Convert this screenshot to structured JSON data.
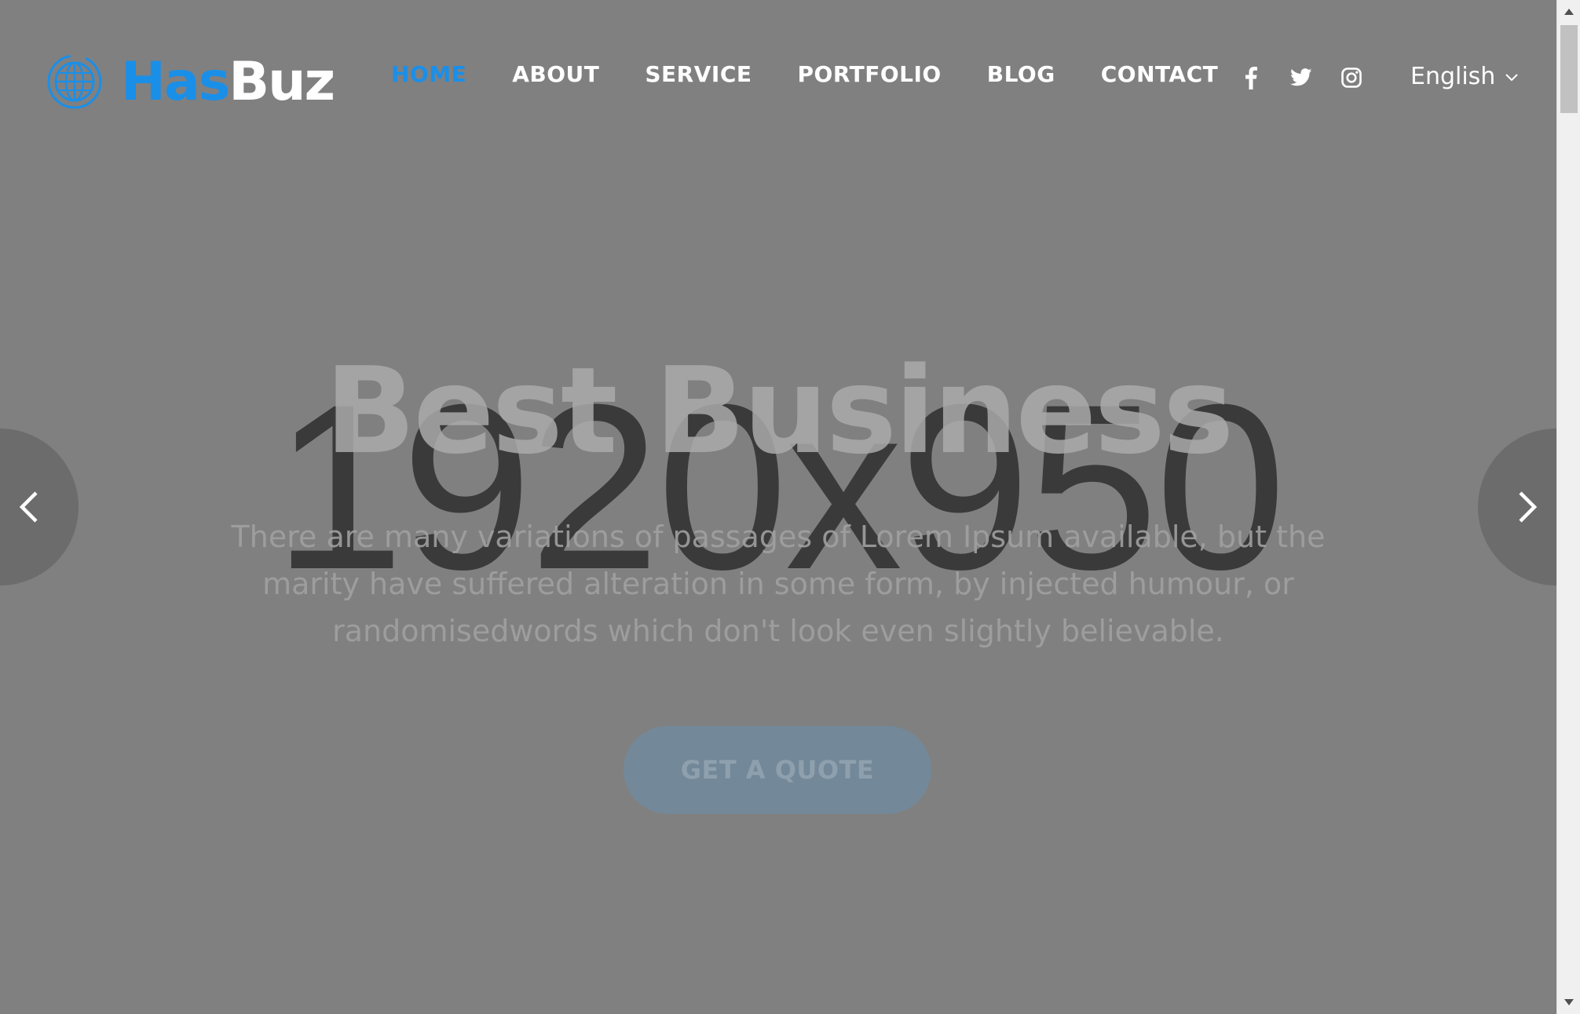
{
  "logo": {
    "part1": "Has",
    "part2": "Buz",
    "mark_icon": "globe-icon"
  },
  "nav": {
    "items": [
      {
        "label": "HOME",
        "active": true
      },
      {
        "label": "ABOUT",
        "active": false
      },
      {
        "label": "SERVICE",
        "active": false
      },
      {
        "label": "PORTFOLIO",
        "active": false
      },
      {
        "label": "BLOG",
        "active": false
      },
      {
        "label": "CONTACT",
        "active": false
      }
    ]
  },
  "social": {
    "icons": [
      "facebook-icon",
      "twitter-icon",
      "instagram-icon"
    ]
  },
  "language": {
    "selected": "English"
  },
  "hero": {
    "placeholder": "1920x950",
    "title": "Best Business",
    "description": "There are many variations of passages of Lorem Ipsum available, but the marity have suffered alteration in some form, by injected humour, or randomisedwords which don't look even slightly believable.",
    "cta_label": "GET A QUOTE"
  },
  "slider": {
    "prev_icon": "chevron-left-icon",
    "next_icon": "chevron-right-icon"
  },
  "colors": {
    "accent": "#1a8fe8",
    "background": "#808080",
    "cta_bg": "#738898"
  }
}
